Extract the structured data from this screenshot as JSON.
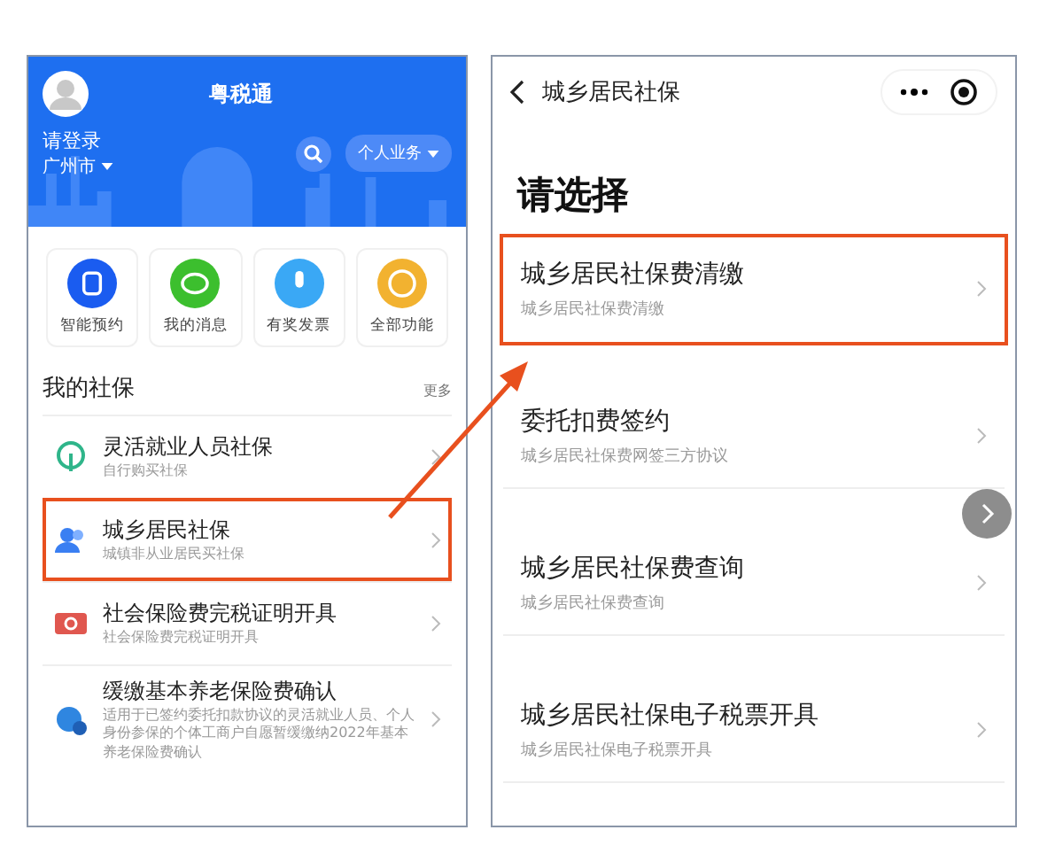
{
  "left_screen": {
    "title": "粤税通",
    "login": "请登录",
    "city": "广州市",
    "business_button": "个人业务",
    "shortcuts": [
      {
        "label": "智能预约",
        "kind": "clock",
        "color": "#1a5cf0"
      },
      {
        "label": "我的消息",
        "kind": "chat",
        "color": "#3cbf2e"
      },
      {
        "label": "有奖发票",
        "kind": "mic",
        "color": "#3aa8f5"
      },
      {
        "label": "全部功能",
        "kind": "more",
        "color": "#f2b230"
      }
    ],
    "section_title": "我的社保",
    "more": "更多",
    "items": [
      {
        "title": "灵活就业人员社保",
        "subtitle": "自行购买社保",
        "kind": "signal",
        "highlighted": false
      },
      {
        "title": "城乡居民社保",
        "subtitle": "城镇非从业居民买社保",
        "kind": "people",
        "highlighted": true
      },
      {
        "title": "社会保险费完税证明开具",
        "subtitle": "社会保险费完税证明开具",
        "kind": "ticket",
        "highlighted": false
      },
      {
        "title": "缓缴基本养老保险费确认",
        "subtitle": "适用于已签约委托扣款协议的灵活就业人员、个人身份参保的个体工商户自愿暂缓缴纳2022年基本养老保险费确认",
        "kind": "cloud",
        "highlighted": false
      }
    ]
  },
  "right_screen": {
    "title": "城乡居民社保",
    "heading": "请选择",
    "items": [
      {
        "title": "城乡居民社保费清缴",
        "subtitle": "城乡居民社保费清缴",
        "highlighted": true
      },
      {
        "title": "委托扣费签约",
        "subtitle": "城乡居民社保费网签三方协议",
        "highlighted": false
      },
      {
        "title": "城乡居民社保费查询",
        "subtitle": "城乡居民社保费查询",
        "highlighted": false
      },
      {
        "title": "城乡居民社保电子税票开具",
        "subtitle": "城乡居民社保电子税票开具",
        "highlighted": false
      }
    ]
  }
}
